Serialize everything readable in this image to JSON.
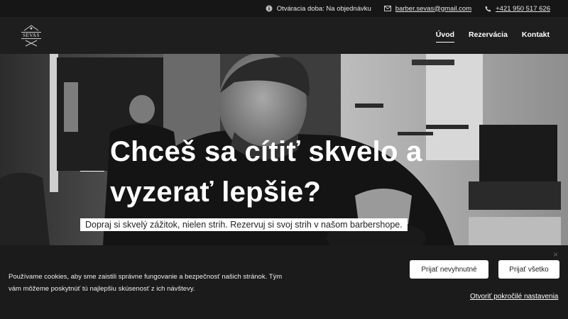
{
  "topbar": {
    "hours": "Otváracia doba: Na objednávku",
    "email": "barber.sevas@gmail.com",
    "phone": "+421 950 517 626"
  },
  "header": {
    "logo_text": "SEVAS",
    "nav": [
      {
        "label": "Úvod",
        "active": true
      },
      {
        "label": "Rezervácia",
        "active": false
      },
      {
        "label": "Kontakt",
        "active": false
      }
    ]
  },
  "hero": {
    "title_line1": "Chceš sa cítiť skvelo a",
    "title_line2": "vyzerať lepšie?",
    "subtitle": "Dopraj si skvelý zážitok, nielen strih. Rezervuj si svoj strih v našom barbershope."
  },
  "cookie": {
    "text": "Používame cookies, aby sme zaistili správne fungovanie a bezpečnosť našich stránok. Tým vám môžeme poskytnúť tú najlepšiu skúsenosť z ich návštevy.",
    "btn_necessary": "Prijať nevyhnutné",
    "btn_all": "Prijať všetko",
    "advanced": "Otvoriť pokročilé nastavenia",
    "close": "×"
  },
  "icons": {
    "info": "info-icon",
    "mail": "mail-icon",
    "phone": "phone-icon",
    "close": "close-icon"
  },
  "colors": {
    "topbar_bg": "#161616",
    "header_bg": "#1e1e1e",
    "cookie_bg": "#1b1b1b",
    "accent_text": "#ffffff"
  }
}
